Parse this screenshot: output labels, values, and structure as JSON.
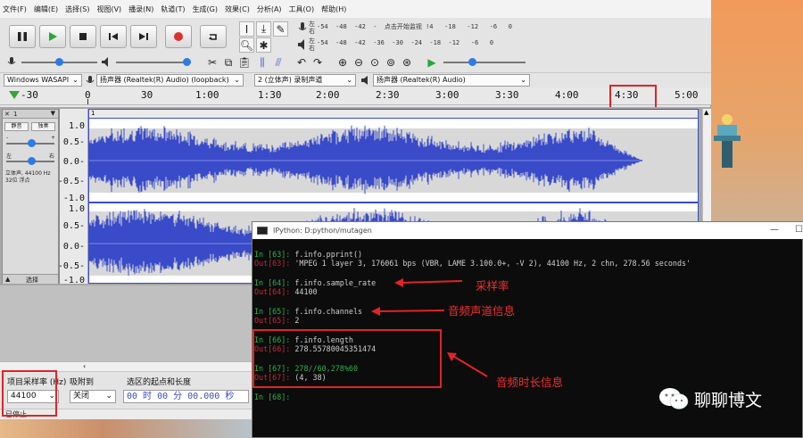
{
  "menubar": {
    "items": [
      "文件(F)",
      "编辑(E)",
      "选择(S)",
      "视图(V)",
      "播录(N)",
      "轨道(T)",
      "生成(G)",
      "效果(C)",
      "分析(A)",
      "工具(O)",
      "帮助(H)"
    ]
  },
  "meters": {
    "record_ticks": "-54  -48  -42  -  点击开始监视 !4   -18   -12   -6   0",
    "play_ticks": "-54  -48  -42  -36  -30  -24  -18  -12   -6   0",
    "lr_left": "左",
    "lr_right": "右"
  },
  "devices": {
    "host": "Windows WASAPI",
    "recording_device": "扬声器 (Realtek(R) Audio) (loopback)",
    "channels": "2 (立体声) 录制声道",
    "playback_device": "扬声器 (Realtek(R) Audio)"
  },
  "timeline": {
    "labels": [
      "-30",
      "0",
      "30",
      "1:00",
      "1:30",
      "2:00",
      "2:30",
      "3:00",
      "3:30",
      "4:00",
      "4:30",
      "5:00"
    ]
  },
  "track": {
    "name": "1",
    "mute": "静音",
    "solo": "独奏",
    "gain_min": "-",
    "gain_max": "+",
    "pan_left": "左",
    "pan_right": "右",
    "info_line1": "立体声, 44100 Hz",
    "info_line2": "32位 浮点",
    "select": "选择",
    "clip_name": "1",
    "ruler_top": [
      "1.0",
      "0.5-",
      "0.0-",
      "-0.5-",
      "-1.0"
    ],
    "ruler_bottom": [
      "1.0",
      "0.5-",
      "0.0-",
      "-0.5-",
      "-1.0"
    ]
  },
  "selection_toolbar": {
    "rate_label": "项目采样率 (Hz)",
    "snap_label": "吸附到",
    "range_label": "选区的起点和长度",
    "rate_value": "44100",
    "snap_value": "关闭",
    "time_value": "00 时 00 分 00.000 秒"
  },
  "status": {
    "text": "已停止"
  },
  "ipython": {
    "title": "IPython: D:python/mutagen",
    "lines": [
      {
        "p": "In [63]: ",
        "kind": "in",
        "t": "f.info.pprint()"
      },
      {
        "p": "Out[63]: ",
        "kind": "out",
        "t": "'MPEG 1 layer 3, 176061 bps (VBR, LAME 3.100.0+, -V 2), 44100 Hz, 2 chn, 278.56 seconds'"
      },
      {
        "p": "In [64]: ",
        "kind": "in",
        "t": "f.info.sample_rate"
      },
      {
        "p": "Out[64]: ",
        "kind": "out",
        "t": "44100"
      },
      {
        "p": "In [65]: ",
        "kind": "in",
        "t": "f.info.channels"
      },
      {
        "p": "Out[65]: ",
        "kind": "out",
        "t": "2"
      },
      {
        "p": "In [66]: ",
        "kind": "in",
        "t": "f.info.length"
      },
      {
        "p": "Out[66]: ",
        "kind": "out",
        "t": "278.55780045351474"
      },
      {
        "p": "In [67]: ",
        "kind": "in",
        "t": "278//60,278%60"
      },
      {
        "p": "Out[67]: ",
        "kind": "out",
        "t": "(4, 38)"
      },
      {
        "p": "In [68]: ",
        "kind": "in",
        "t": ""
      }
    ]
  },
  "annotations": {
    "sample_rate": "采样率",
    "channels": "音频声道信息",
    "duration": "音频时长信息"
  },
  "watermark": {
    "text": "聊聊博文"
  },
  "colors": {
    "waveform": "#3a4bc9",
    "annotation": "#e02424",
    "prompt_in": "#2bb34b",
    "prompt_out": "#c9263a"
  }
}
